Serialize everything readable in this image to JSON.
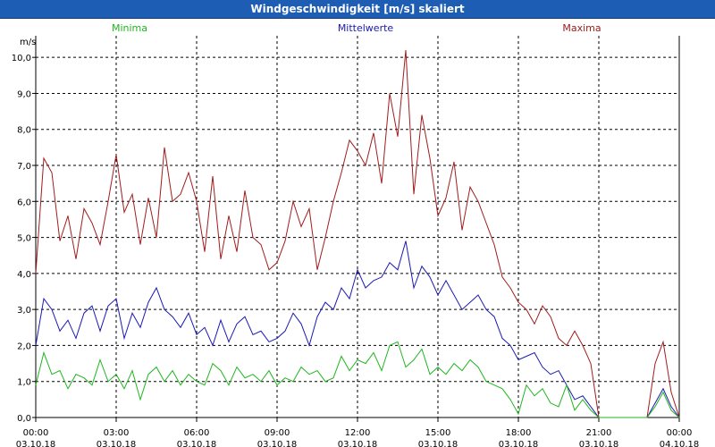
{
  "window": {
    "title": "Windgeschwindigkeit [m/s] skaliert"
  },
  "legend": [
    {
      "label": "Minima",
      "color": "#1fb61f"
    },
    {
      "label": "Mittelwerte",
      "color": "#1a1ab3"
    },
    {
      "label": "Maxima",
      "color": "#a01c1c"
    }
  ],
  "chart_data": {
    "type": "line",
    "ylabel": "m/s",
    "ylim": [
      0,
      10.6
    ],
    "xlim_hours": [
      0,
      24
    ],
    "grid": true,
    "legend_position": "top",
    "yticks": [
      "0,0",
      "1,0",
      "2,0",
      "3,0",
      "4,0",
      "5,0",
      "6,0",
      "7,0",
      "8,0",
      "9,0",
      "10,0"
    ],
    "ytick_values": [
      0,
      1,
      2,
      3,
      4,
      5,
      6,
      7,
      8,
      9,
      10
    ],
    "xticks": [
      {
        "time": "00:00",
        "date": "03.10.18"
      },
      {
        "time": "03:00",
        "date": "03.10.18"
      },
      {
        "time": "06:00",
        "date": "03.10.18"
      },
      {
        "time": "09:00",
        "date": "03.10.18"
      },
      {
        "time": "12:00",
        "date": "03.10.18"
      },
      {
        "time": "15:00",
        "date": "03.10.18"
      },
      {
        "time": "18:00",
        "date": "03.10.18"
      },
      {
        "time": "21:00",
        "date": "03.10.18"
      },
      {
        "time": "00:00",
        "date": "04.10.18"
      }
    ],
    "series": [
      {
        "name": "Maxima",
        "color": "#a01c1c",
        "x": [
          0,
          0.3,
          0.6,
          0.9,
          1.2,
          1.5,
          1.8,
          2.1,
          2.4,
          2.7,
          3.0,
          3.3,
          3.6,
          3.9,
          4.2,
          4.5,
          4.8,
          5.1,
          5.4,
          5.7,
          6.0,
          6.3,
          6.6,
          6.9,
          7.2,
          7.5,
          7.8,
          8.1,
          8.4,
          8.7,
          9.0,
          9.3,
          9.6,
          9.9,
          10.2,
          10.5,
          10.8,
          11.1,
          11.4,
          11.7,
          12.0,
          12.3,
          12.6,
          12.9,
          13.2,
          13.5,
          13.8,
          14.1,
          14.4,
          14.7,
          15.0,
          15.3,
          15.6,
          15.9,
          16.2,
          16.5,
          16.8,
          17.1,
          17.4,
          17.7,
          18.0,
          18.3,
          18.6,
          18.9,
          19.2,
          19.5,
          19.8,
          20.1,
          20.4,
          20.7,
          21.0,
          21.3,
          21.6,
          21.9,
          22.2,
          22.5,
          22.8,
          23.1,
          23.4,
          23.7,
          24.0
        ],
        "values": [
          4.0,
          7.2,
          6.8,
          4.9,
          5.6,
          4.4,
          5.8,
          5.4,
          4.8,
          6.0,
          7.3,
          5.7,
          6.2,
          4.8,
          6.1,
          5.0,
          7.5,
          6.0,
          6.2,
          6.8,
          6.0,
          4.6,
          6.7,
          4.4,
          5.6,
          4.6,
          6.3,
          5.0,
          4.8,
          4.1,
          4.3,
          4.9,
          6.0,
          5.3,
          5.8,
          4.1,
          5.0,
          6.0,
          6.8,
          7.7,
          7.4,
          7.0,
          7.9,
          6.5,
          9.0,
          7.8,
          10.2,
          6.2,
          8.4,
          7.2,
          5.6,
          6.1,
          7.1,
          5.2,
          6.4,
          6.0,
          5.4,
          4.8,
          3.9,
          3.6,
          3.2,
          3.0,
          2.6,
          3.1,
          2.8,
          2.2,
          2.0,
          2.4,
          2.0,
          1.5,
          0.0,
          0.0,
          0.0,
          0.0,
          0.0,
          0.0,
          0.0,
          1.5,
          2.1,
          0.7,
          0.0
        ]
      },
      {
        "name": "Mittelwerte",
        "color": "#1a1ab3",
        "x": [
          0,
          0.3,
          0.6,
          0.9,
          1.2,
          1.5,
          1.8,
          2.1,
          2.4,
          2.7,
          3.0,
          3.3,
          3.6,
          3.9,
          4.2,
          4.5,
          4.8,
          5.1,
          5.4,
          5.7,
          6.0,
          6.3,
          6.6,
          6.9,
          7.2,
          7.5,
          7.8,
          8.1,
          8.4,
          8.7,
          9.0,
          9.3,
          9.6,
          9.9,
          10.2,
          10.5,
          10.8,
          11.1,
          11.4,
          11.7,
          12.0,
          12.3,
          12.6,
          12.9,
          13.2,
          13.5,
          13.8,
          14.1,
          14.4,
          14.7,
          15.0,
          15.3,
          15.6,
          15.9,
          16.2,
          16.5,
          16.8,
          17.1,
          17.4,
          17.7,
          18.0,
          18.3,
          18.6,
          18.9,
          19.2,
          19.5,
          19.8,
          20.1,
          20.4,
          20.7,
          21.0,
          21.3,
          21.6,
          21.9,
          22.2,
          22.5,
          22.8,
          23.1,
          23.4,
          23.7,
          24.0
        ],
        "values": [
          2.0,
          3.3,
          3.0,
          2.4,
          2.7,
          2.2,
          2.9,
          3.1,
          2.4,
          3.1,
          3.3,
          2.2,
          2.9,
          2.5,
          3.2,
          3.6,
          3.0,
          2.8,
          2.5,
          2.9,
          2.3,
          2.5,
          2.0,
          2.7,
          2.1,
          2.6,
          2.8,
          2.3,
          2.4,
          2.1,
          2.2,
          2.4,
          2.9,
          2.6,
          2.0,
          2.8,
          3.2,
          3.0,
          3.6,
          3.3,
          4.1,
          3.6,
          3.8,
          3.9,
          4.3,
          4.1,
          4.9,
          3.6,
          4.2,
          3.9,
          3.4,
          3.8,
          3.4,
          3.0,
          3.2,
          3.4,
          3.0,
          2.8,
          2.2,
          2.0,
          1.6,
          1.7,
          1.8,
          1.4,
          1.2,
          1.3,
          0.9,
          0.5,
          0.6,
          0.3,
          0.0,
          0.0,
          0.0,
          0.0,
          0.0,
          0.0,
          0.0,
          0.4,
          0.8,
          0.3,
          0.0
        ]
      },
      {
        "name": "Minima",
        "color": "#1fb61f",
        "x": [
          0,
          0.3,
          0.6,
          0.9,
          1.2,
          1.5,
          1.8,
          2.1,
          2.4,
          2.7,
          3.0,
          3.3,
          3.6,
          3.9,
          4.2,
          4.5,
          4.8,
          5.1,
          5.4,
          5.7,
          6.0,
          6.3,
          6.6,
          6.9,
          7.2,
          7.5,
          7.8,
          8.1,
          8.4,
          8.7,
          9.0,
          9.3,
          9.6,
          9.9,
          10.2,
          10.5,
          10.8,
          11.1,
          11.4,
          11.7,
          12.0,
          12.3,
          12.6,
          12.9,
          13.2,
          13.5,
          13.8,
          14.1,
          14.4,
          14.7,
          15.0,
          15.3,
          15.6,
          15.9,
          16.2,
          16.5,
          16.8,
          17.1,
          17.4,
          17.7,
          18.0,
          18.3,
          18.6,
          18.9,
          19.2,
          19.5,
          19.8,
          20.1,
          20.4,
          20.7,
          21.0,
          21.3,
          21.6,
          21.9,
          22.2,
          22.5,
          22.8,
          23.1,
          23.4,
          23.7,
          24.0
        ],
        "values": [
          0.9,
          1.8,
          1.2,
          1.3,
          0.8,
          1.2,
          1.1,
          0.9,
          1.6,
          1.0,
          1.2,
          0.8,
          1.3,
          0.5,
          1.2,
          1.4,
          1.0,
          1.3,
          0.9,
          1.2,
          1.0,
          0.9,
          1.5,
          1.3,
          0.9,
          1.4,
          1.1,
          1.2,
          1.0,
          1.3,
          0.9,
          1.1,
          1.0,
          1.4,
          1.2,
          1.3,
          1.0,
          1.1,
          1.7,
          1.3,
          1.6,
          1.5,
          1.8,
          1.3,
          2.0,
          2.1,
          1.4,
          1.6,
          1.9,
          1.2,
          1.4,
          1.2,
          1.5,
          1.3,
          1.6,
          1.4,
          1.0,
          0.9,
          0.8,
          0.5,
          0.1,
          0.9,
          0.6,
          0.8,
          0.4,
          0.3,
          0.9,
          0.2,
          0.5,
          0.2,
          0.0,
          0.0,
          0.0,
          0.0,
          0.0,
          0.0,
          0.0,
          0.3,
          0.7,
          0.2,
          0.0
        ]
      }
    ]
  }
}
